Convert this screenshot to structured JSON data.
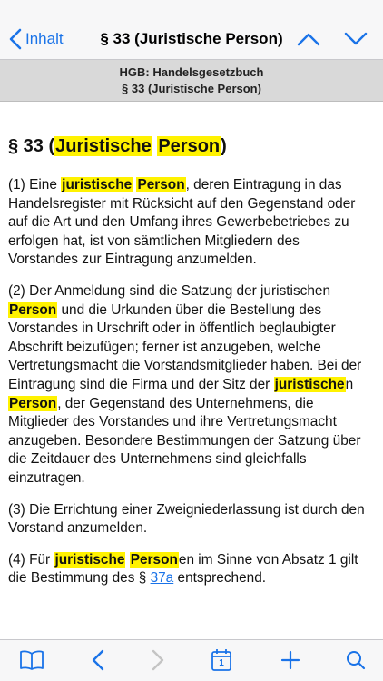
{
  "colors": {
    "accent": "#1a73e8",
    "highlight": "#fff200",
    "disabled": "#c4c4c4"
  },
  "nav": {
    "back_label": "Inhalt",
    "title": "§ 33 (Juristische Person)"
  },
  "subheader": {
    "line1": "HGB: Handelsgesetzbuch",
    "line2": "§ 33 (Juristische Person)"
  },
  "heading": {
    "prefix": "§ 33 (",
    "hl1": "Juristische",
    "space": " ",
    "hl2": "Person",
    "suffix": ")"
  },
  "p1": {
    "a": "(1) Eine ",
    "hl1": "juristische",
    "b": " ",
    "hl2": "Person",
    "c": ", deren Eintragung in das Handelsregister mit Rücksicht auf den Gegenstand oder auf die Art und den Umfang ihres Gewerbebetriebes zu erfolgen hat, ist von sämtlichen Mitgliedern des Vorstandes zur Eintragung anzumelden."
  },
  "p2": {
    "a": "(2) Der Anmeldung sind die Satzung der juristischen ",
    "hl1": "Person",
    "b": " und die Urkunden über die Bestellung des Vorstandes in Urschrift oder in öffentlich beglaubigter Abschrift beizufügen; ferner ist anzugeben, welche Vertretungsmacht die Vorstandsmitglieder haben. Bei der Eintragung sind die Firma und der Sitz der ",
    "hl2": "juristische",
    "c": "n ",
    "hl3": "Person",
    "d": ", der Gegenstand des Unternehmens, die Mitglieder des Vorstandes und ihre Vertretungsmacht anzugeben. Besondere Bestimmungen der Satzung über die Zeitdauer des Unternehmens sind gleichfalls einzutragen."
  },
  "p3": {
    "text": "(3) Die Errichtung einer Zweigniederlassung ist durch den Vorstand anzumelden."
  },
  "p4": {
    "a": "(4) Für ",
    "hl1": "juristische",
    "b": " ",
    "hl2": "Person",
    "c": "en im Sinne von Absatz 1 gilt die Bestimmung des § ",
    "link": "37a",
    "d": " entsprechend."
  },
  "toolbar": {
    "calendar_day": "1"
  }
}
